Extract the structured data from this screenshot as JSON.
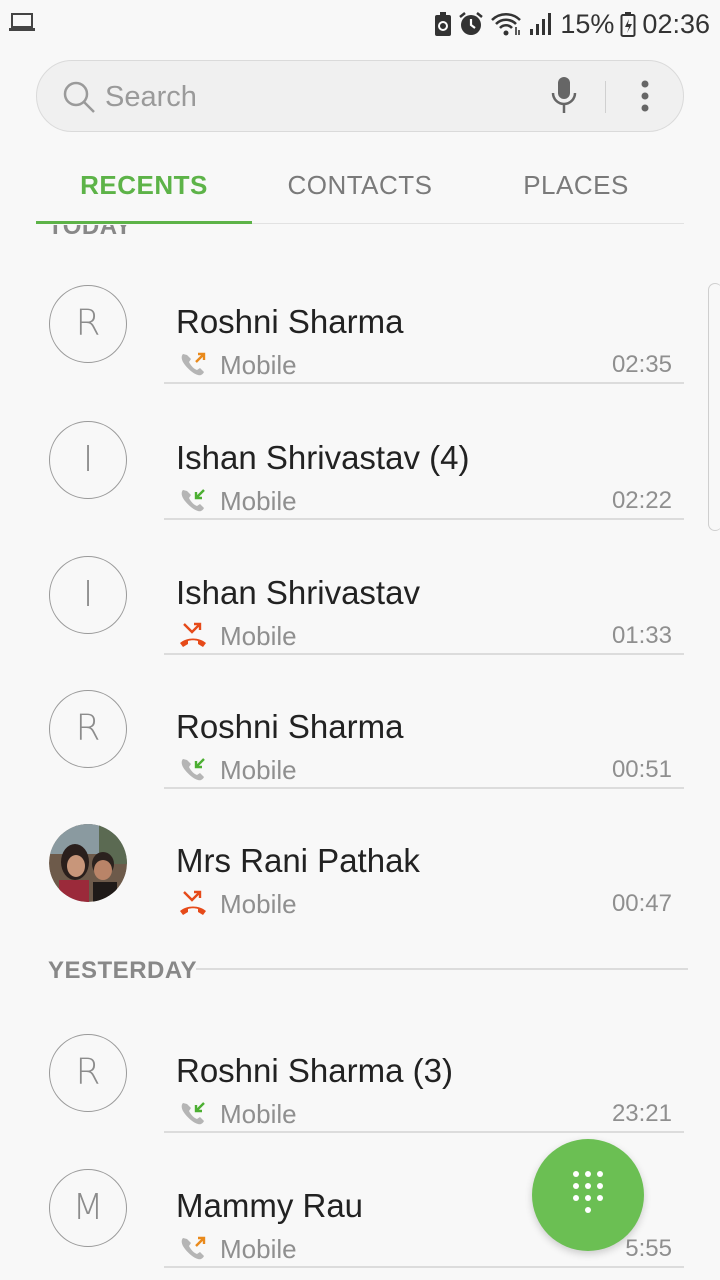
{
  "status_bar": {
    "left_icon": "laptop-icon",
    "icons": [
      "battery-saver-icon",
      "alarm-icon",
      "wifi-icon",
      "signal-icon"
    ],
    "battery_percent": "15%",
    "battery_icon": "battery-charging-icon",
    "time": "02:36"
  },
  "search": {
    "placeholder": "Search",
    "icon": "search-icon",
    "mic_icon": "mic-icon",
    "menu_icon": "more-vert-icon"
  },
  "tabs": [
    {
      "label": "RECENTS",
      "active": true
    },
    {
      "label": "CONTACTS",
      "active": false
    },
    {
      "label": "PLACES",
      "active": false
    }
  ],
  "sections": {
    "today": "TODAY",
    "yesterday": "YESTERDAY"
  },
  "calls": [
    {
      "initial": "R",
      "name": "Roshni Sharma",
      "call_type": "outgoing",
      "type_label": "Mobile",
      "time": "02:35"
    },
    {
      "initial": "I",
      "name": "Ishan Shrivastav (4)",
      "call_type": "incoming",
      "type_label": "Mobile",
      "time": "02:22"
    },
    {
      "initial": "I",
      "name": "Ishan Shrivastav",
      "call_type": "missed",
      "type_label": "Mobile",
      "time": "01:33"
    },
    {
      "initial": "R",
      "name": "Roshni Sharma",
      "call_type": "incoming",
      "type_label": "Mobile",
      "time": "00:51"
    },
    {
      "initial": "",
      "name": "Mrs Rani Pathak",
      "call_type": "missed",
      "type_label": "Mobile",
      "time": "00:47",
      "photo": true
    },
    {
      "initial": "R",
      "name": "Roshni Sharma (3)",
      "call_type": "incoming",
      "type_label": "Mobile",
      "time": "23:21"
    },
    {
      "initial": "M",
      "name": "Mammy Rau",
      "call_type": "outgoing",
      "type_label": "Mobile",
      "time": "5:55"
    }
  ],
  "colors": {
    "accent": "#5db348",
    "fab": "#6bbf53",
    "outgoing_arrow": "#e98a1c",
    "incoming_arrow": "#4caf32",
    "missed": "#e64a19"
  },
  "fab": {
    "icon": "dialpad-icon"
  }
}
